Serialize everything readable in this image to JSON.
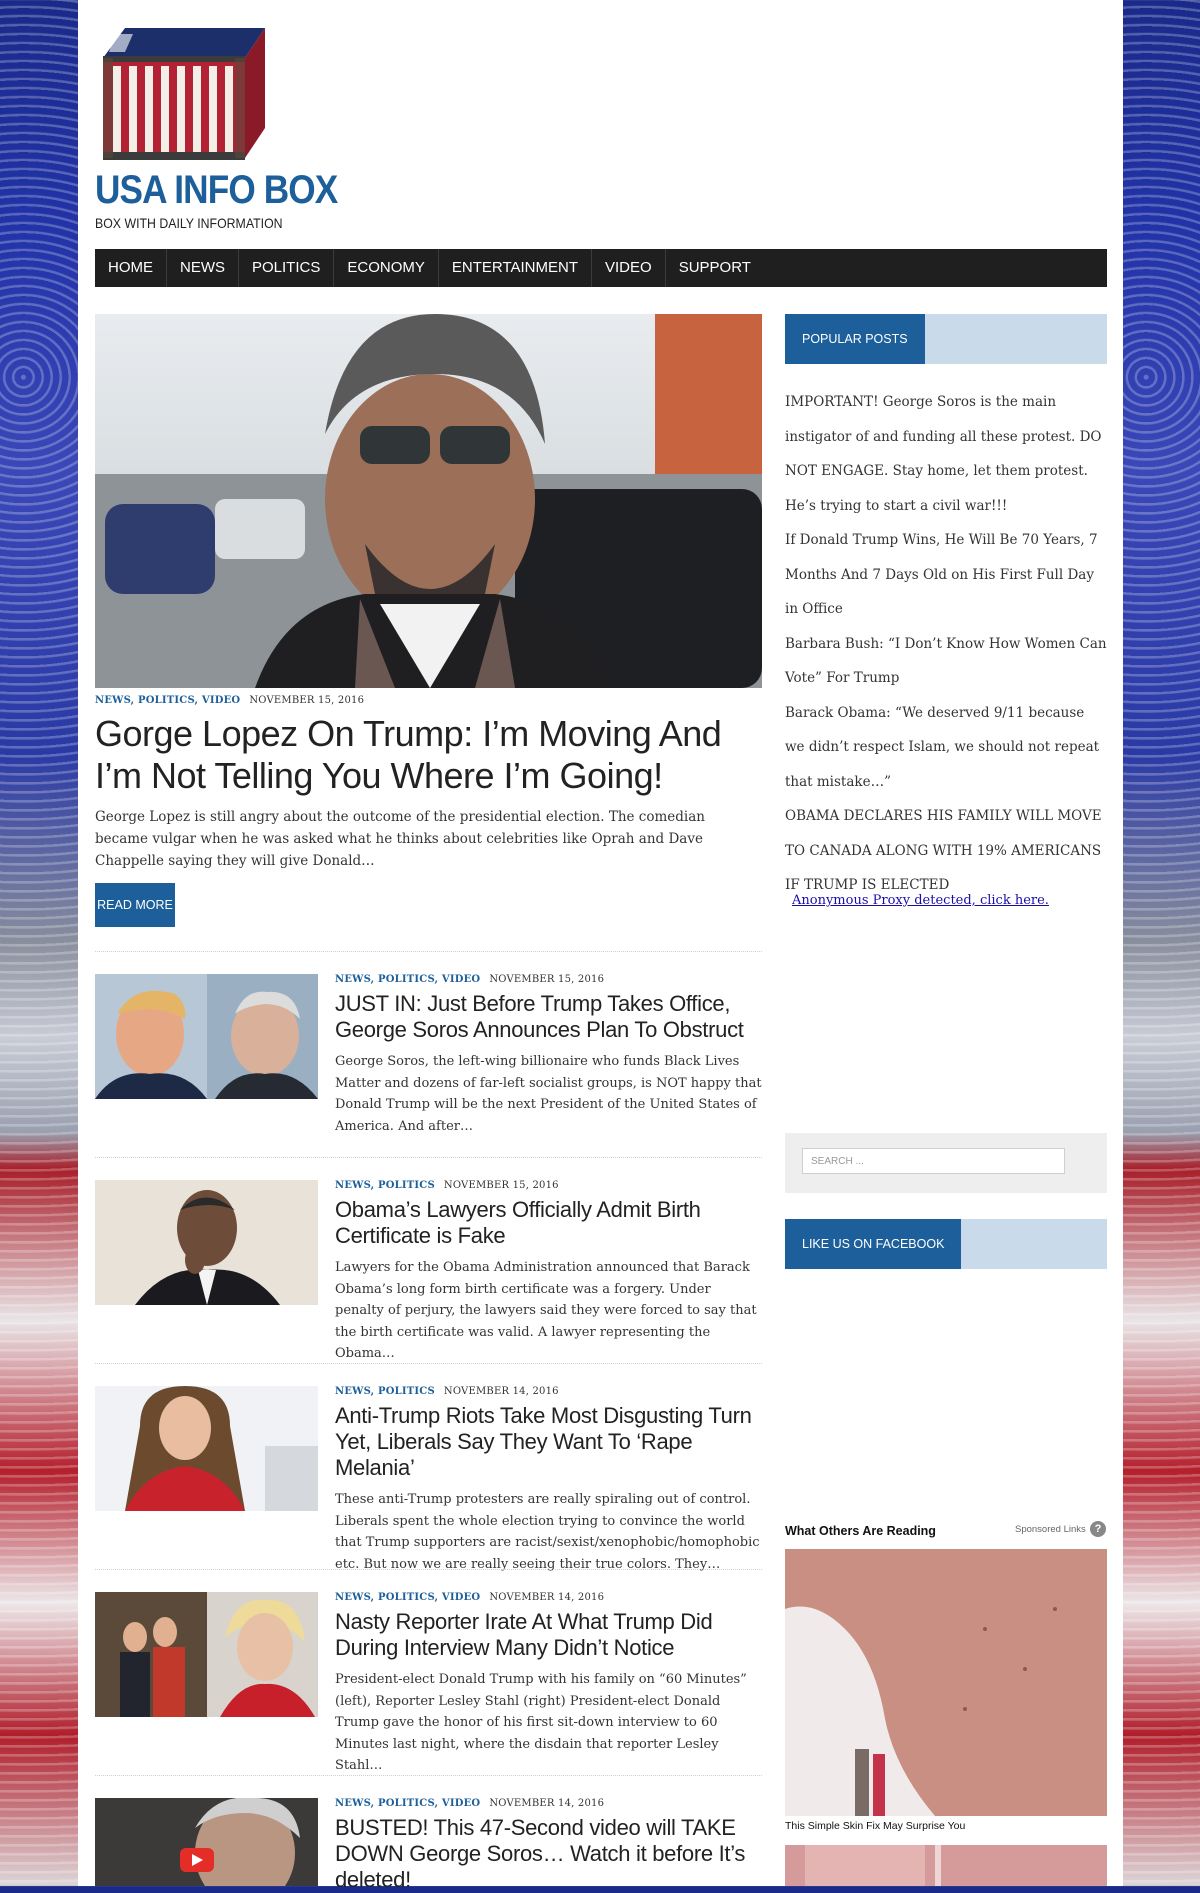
{
  "site": {
    "title": "USA INFO BOX",
    "tagline": "BOX WITH DAILY INFORMATION"
  },
  "nav": {
    "items": [
      "HOME",
      "NEWS",
      "POLITICS",
      "ECONOMY",
      "ENTERTAINMENT",
      "VIDEO",
      "SUPPORT"
    ]
  },
  "featured": {
    "categories": "NEWS, POLITICS, VIDEO",
    "date": "NOVEMBER 15, 2016",
    "title": "Gorge Lopez On Trump: I’m Moving And I’m Not Telling You Where I’m Going!",
    "excerpt": "George Lopez is still angry about the outcome of the presidential election. The comedian became vulgar when he was asked what he thinks about celebrities like Oprah and Dave Chappelle saying they will give Donald…",
    "read_more": "READ MORE"
  },
  "posts": [
    {
      "categories": "NEWS, POLITICS, VIDEO",
      "date": "NOVEMBER 15, 2016",
      "title": "JUST IN: Just Before Trump Takes Office, George Soros Announces Plan To Obstruct",
      "excerpt": "George Soros, the left-wing billionaire who funds Black Lives Matter and dozens of far-left socialist groups, is NOT happy that Donald Trump will be the next President of the United States of America. And after…"
    },
    {
      "categories": "NEWS, POLITICS",
      "date": "NOVEMBER 15, 2016",
      "title": "Obama’s Lawyers Officially Admit Birth Certificate is Fake",
      "excerpt": "Lawyers for the Obama Administration announced that Barack Obama’s long form birth certificate was a forgery. Under penalty of perjury, the lawyers said they were forced to say that the birth certificate was valid. A lawyer representing the Obama…"
    },
    {
      "categories": "NEWS, POLITICS",
      "date": "NOVEMBER 14, 2016",
      "title": "Anti-Trump Riots Take Most Disgusting Turn Yet, Liberals Say They Want To ‘Rape Melania’",
      "excerpt": "These anti-Trump protesters are really spiraling out of control. Liberals spent the whole election trying to convince the world that Trump supporters are racist/sexist/xenophobic/homophobic etc. But now we are really seeing their true colors.  They…"
    },
    {
      "categories": "NEWS, POLITICS, VIDEO",
      "date": "NOVEMBER 14, 2016",
      "title": "Nasty Reporter Irate At What Trump Did During Interview Many Didn’t Notice",
      "excerpt": "President-elect Donald Trump with his family on “60 Minutes” (left), Reporter Lesley Stahl (right) President-elect Donald Trump gave the honor of his first sit-down interview to 60 Minutes last night, where the disdain that reporter Lesley Stahl…"
    },
    {
      "categories": "NEWS, POLITICS, VIDEO",
      "date": "NOVEMBER 14, 2016",
      "title": "BUSTED! This 47-Second video will TAKE DOWN George Soros… Watch it before It’s deleted!",
      "excerpt": ""
    }
  ],
  "sidebar": {
    "popular_heading": "POPULAR POSTS",
    "popular": [
      "IMPORTANT! George Soros is the main instigator of and funding all these protest. DO NOT ENGAGE. Stay home, let them protest. He’s trying to start a civil war!!!",
      "If Donald Trump Wins, He Will Be 70 Years, 7 Months And 7 Days Old on His First Full Day in Office",
      "Barbara Bush: “I Don’t Know How Women Can Vote” For Trump",
      "Barack Obama: “We deserved 9/11 because we didn’t respect Islam, we should not repeat that mistake…”",
      "OBAMA DECLARES HIS FAMILY WILL MOVE TO CANADA ALONG WITH 19% AMERICANS IF TRUMP IS ELECTED"
    ],
    "proxy_link": "Anonymous Proxy detected, click here.",
    "search_placeholder": "SEARCH ...",
    "facebook_heading": "LIKE US ON FACEBOOK",
    "others_title": "What Others Are Reading",
    "sponsored": "Sponsored Links",
    "help": "?",
    "ad_caption": "This Simple Skin Fix May Surprise You"
  },
  "colors": {
    "brand": "#1d5f9a",
    "nav_bg": "#1f1f1f",
    "widget_band": "#c9dbeb"
  }
}
